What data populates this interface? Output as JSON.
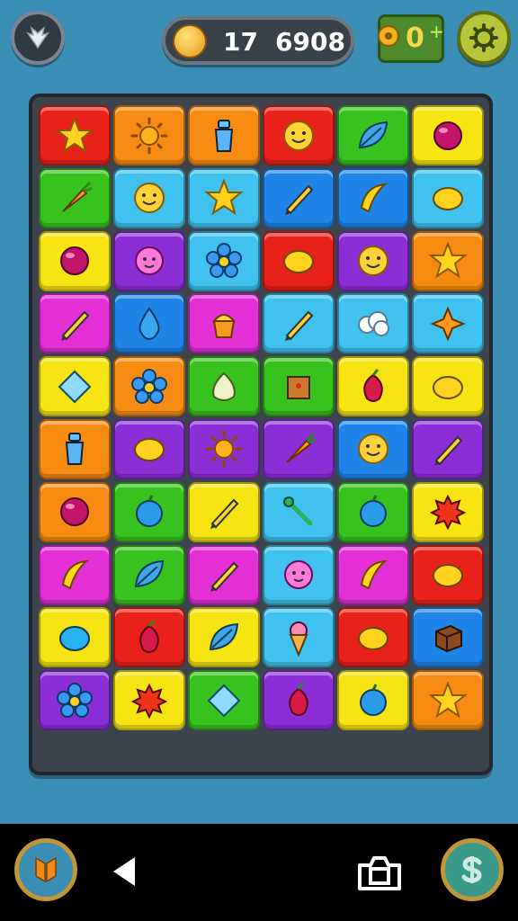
{
  "hud": {
    "moves": "17",
    "score": "6908",
    "gems": "0",
    "gem_plus": "+"
  },
  "colors": {
    "red": "#e8221a",
    "orange": "#f78b12",
    "yellow": "#f5e312",
    "green": "#38c21e",
    "cyan": "#3fc3ee",
    "blue": "#1f84e8",
    "purple": "#8a2ed6",
    "magenta": "#e22fd6"
  },
  "board": {
    "rows": [
      [
        {
          "color": "red",
          "icon": "star"
        },
        {
          "color": "orange",
          "icon": "sun"
        },
        {
          "color": "orange",
          "icon": "bottle"
        },
        {
          "color": "red",
          "icon": "smiley"
        },
        {
          "color": "green",
          "icon": "leaf"
        },
        {
          "color": "yellow",
          "icon": "ball"
        }
      ],
      [
        {
          "color": "green",
          "icon": "carrot"
        },
        {
          "color": "cyan",
          "icon": "smiley"
        },
        {
          "color": "cyan",
          "icon": "star"
        },
        {
          "color": "blue",
          "icon": "pencil"
        },
        {
          "color": "blue",
          "icon": "banana"
        },
        {
          "color": "cyan",
          "icon": "lemon"
        }
      ],
      [
        {
          "color": "yellow",
          "icon": "ball"
        },
        {
          "color": "purple",
          "icon": "flower-face"
        },
        {
          "color": "cyan",
          "icon": "flower"
        },
        {
          "color": "red",
          "icon": "lemon"
        },
        {
          "color": "purple",
          "icon": "smiley"
        },
        {
          "color": "orange",
          "icon": "star"
        }
      ],
      [
        {
          "color": "magenta",
          "icon": "pencil"
        },
        {
          "color": "blue",
          "icon": "drop"
        },
        {
          "color": "magenta",
          "icon": "cupcake"
        },
        {
          "color": "cyan",
          "icon": "pencil"
        },
        {
          "color": "cyan",
          "icon": "cloud"
        },
        {
          "color": "cyan",
          "icon": "sparkle"
        }
      ],
      [
        {
          "color": "yellow",
          "icon": "diamond"
        },
        {
          "color": "orange",
          "icon": "flower"
        },
        {
          "color": "green",
          "icon": "onion"
        },
        {
          "color": "green",
          "icon": "box"
        },
        {
          "color": "yellow",
          "icon": "radish"
        },
        {
          "color": "yellow",
          "icon": "lemon"
        }
      ],
      [
        {
          "color": "orange",
          "icon": "bottle"
        },
        {
          "color": "purple",
          "icon": "lemon"
        },
        {
          "color": "purple",
          "icon": "sun"
        },
        {
          "color": "purple",
          "icon": "carrot"
        },
        {
          "color": "blue",
          "icon": "smiley"
        },
        {
          "color": "purple",
          "icon": "pencil"
        }
      ],
      [
        {
          "color": "orange",
          "icon": "ball"
        },
        {
          "color": "green",
          "icon": "apple"
        },
        {
          "color": "yellow",
          "icon": "pencil"
        },
        {
          "color": "cyan",
          "icon": "stick"
        },
        {
          "color": "green",
          "icon": "apple"
        },
        {
          "color": "yellow",
          "icon": "splat"
        }
      ],
      [
        {
          "color": "magenta",
          "icon": "banana"
        },
        {
          "color": "green",
          "icon": "leaf"
        },
        {
          "color": "magenta",
          "icon": "pencil"
        },
        {
          "color": "cyan",
          "icon": "flower-face"
        },
        {
          "color": "magenta",
          "icon": "banana"
        },
        {
          "color": "red",
          "icon": "lemon"
        }
      ],
      [
        {
          "color": "yellow",
          "icon": "oval"
        },
        {
          "color": "red",
          "icon": "radish"
        },
        {
          "color": "yellow",
          "icon": "leaf"
        },
        {
          "color": "cyan",
          "icon": "icecream"
        },
        {
          "color": "red",
          "icon": "lemon"
        },
        {
          "color": "blue",
          "icon": "cube"
        }
      ],
      [
        {
          "color": "purple",
          "icon": "flower"
        },
        {
          "color": "yellow",
          "icon": "splat"
        },
        {
          "color": "green",
          "icon": "diamond"
        },
        {
          "color": "purple",
          "icon": "radish"
        },
        {
          "color": "yellow",
          "icon": "apple"
        },
        {
          "color": "orange",
          "icon": "star"
        }
      ]
    ]
  },
  "nav": {
    "left_icon": "bookmark-icon",
    "back_icon": "back-triangle-icon",
    "screenshot_icon": "camera-icon",
    "right_icon": "dollar-icon"
  }
}
